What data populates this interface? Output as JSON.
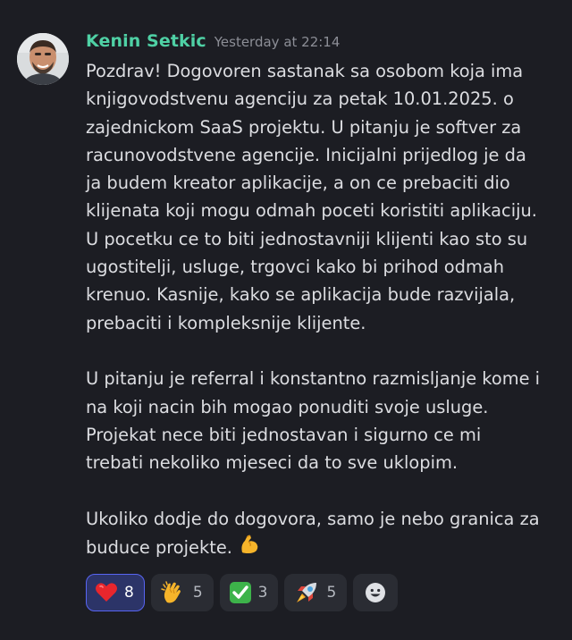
{
  "message": {
    "author": "Kenin Setkic",
    "timestamp": "Yesterday at 22:14",
    "avatar_icon": "avatar-photo",
    "paragraphs": [
      {
        "lines": [
          "Pozdrav! Dogovoren sastanak sa osobom koja ima",
          "knjigovodstvenu agenciju za petak 10.01.2025. o",
          "zajednickom SaaS projektu. U pitanju je softver za",
          "racunovodstvene agencije. Inicijalni prijedlog je da",
          "ja budem kreator aplikacije, a on ce prebaciti dio",
          "klijenata koji mogu odmah poceti koristiti aplikaciju.",
          "U pocetku ce to biti jednostavniji klijenti kao sto su",
          "ugostitelji, usluge, trgovci kako bi prihod odmah",
          "krenuo. Kasnije, kako se aplikacija bude razvijala,",
          "prebaciti i kompleksnije klijente."
        ]
      },
      {
        "lines": [
          "U pitanju je referral i konstantno razmisljanje kome i",
          "na koji nacin bih mogao ponuditi svoje usluge.",
          "Projekat nece biti jednostavan i sigurno ce mi",
          "trebati nekoliko mjeseci da to sve uklopim."
        ]
      },
      {
        "lines": [
          "Ukoliko dodje do dogovora, samo je nebo granica za",
          "buduce projekte."
        ],
        "trailing_emoji": "flexed-biceps-emoji"
      }
    ]
  },
  "reactions": [
    {
      "emoji": "red-heart-emoji",
      "count": "8",
      "active": true
    },
    {
      "emoji": "clapping-hands-emoji",
      "count": "5",
      "active": false
    },
    {
      "emoji": "check-mark-button-emoji",
      "count": "3",
      "active": false
    },
    {
      "emoji": "rocket-emoji",
      "count": "5",
      "active": false
    }
  ],
  "add_reaction_icon": "smiley-face-icon",
  "colors": {
    "background": "#1c1d23",
    "author_name": "#4fd1a5",
    "timestamp": "#8c8e96",
    "text": "#dcdde1",
    "reaction_bg": "#2a2c33",
    "reaction_active_bg": "#2c3468",
    "reaction_active_border": "#5865f2"
  }
}
